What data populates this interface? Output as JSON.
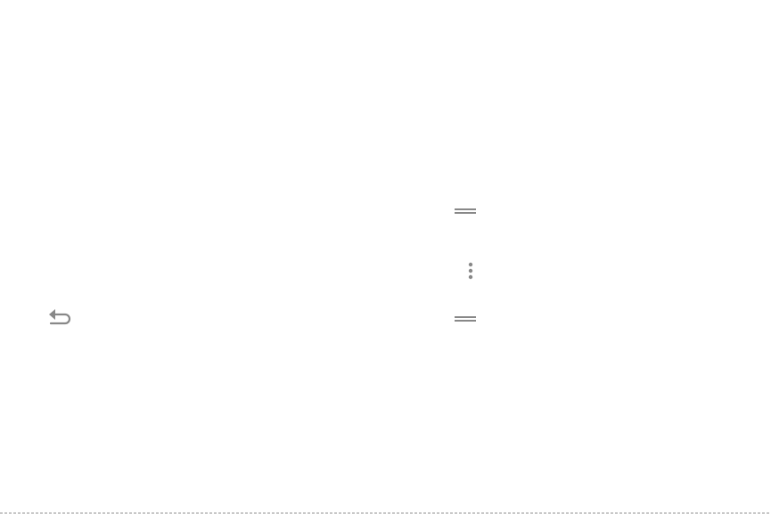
{
  "colors": {
    "background": "#ffffff",
    "icon": "#888888",
    "rule": "#c8c8c8"
  },
  "icons": {
    "back": "back-arrow-icon",
    "menu_top": "drag-handle-icon",
    "overflow": "more-vert-icon",
    "menu_bottom": "drag-handle-icon"
  }
}
